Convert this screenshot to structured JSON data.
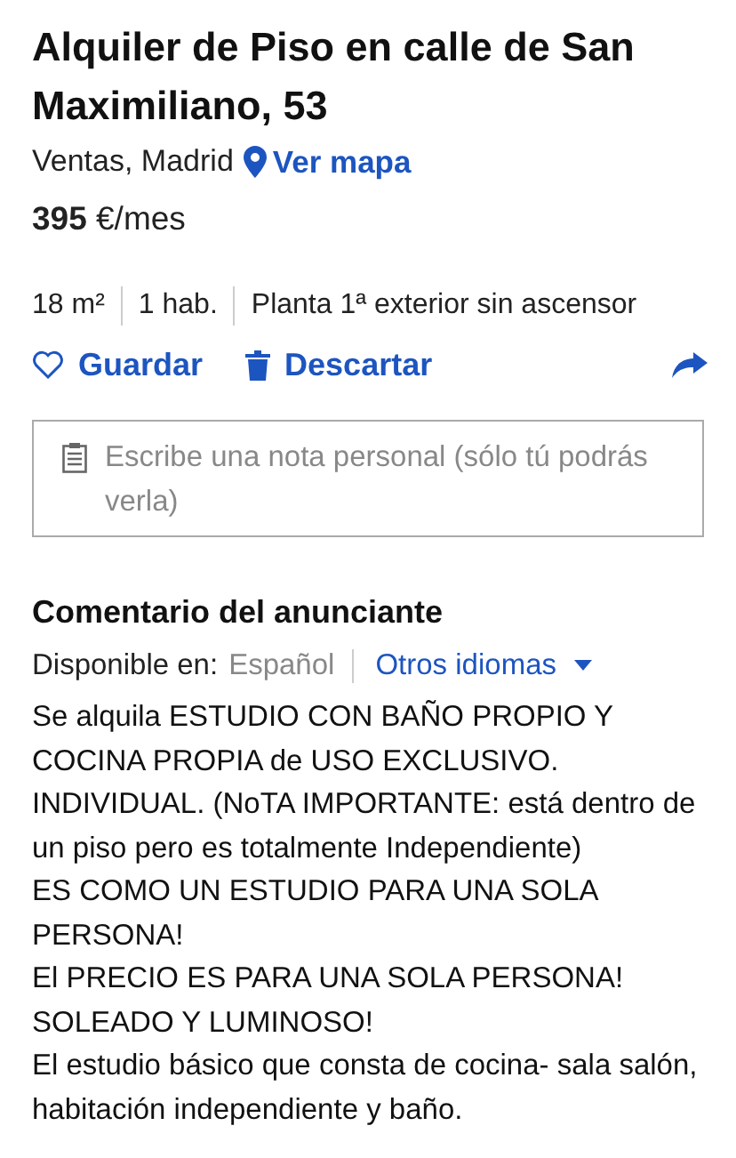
{
  "title": "Alquiler de Piso en calle de San Maximiliano, 53",
  "location": {
    "area": "Ventas, Madrid",
    "map_link": "Ver mapa"
  },
  "price": "**395** €/mes",
  "features": [
    "18 m²",
    "1 hab.",
    "Planta 1ª exterior sin ascensor"
  ],
  "actions": [
    {
      "kind": "save",
      "label": "Guardar"
    },
    {
      "kind": "discard",
      "label": "Descartar"
    },
    {
      "kind": "share"
    }
  ],
  "note": {
    "placeholder": "Escribe una nota personal (sólo tú podrás verla)"
  },
  "comment": {
    "heading": "Comentario del anunciante",
    "available_label": "Disponible en:",
    "language": "Español",
    "other_languages": "Otros idiomas",
    "paragraphs": [
      "Se alquila ESTUDIO CON BAÑO PROPIO Y COCINA PROPIA de USO EXCLUSIVO.",
      "INDIVIDUAL. (NoTA IMPORTANTE: está dentro de un piso pero es totalmente Independiente)",
      "ES COMO UN ESTUDIO PARA UNA SOLA PERSONA!",
      "El PRECIO ES PARA UNA SOLA PERSONA!",
      "SOLEADO Y LUMINOSO!",
      "El estudio básico que consta de cocina- sala salón, habitación independiente y baño."
    ]
  }
}
